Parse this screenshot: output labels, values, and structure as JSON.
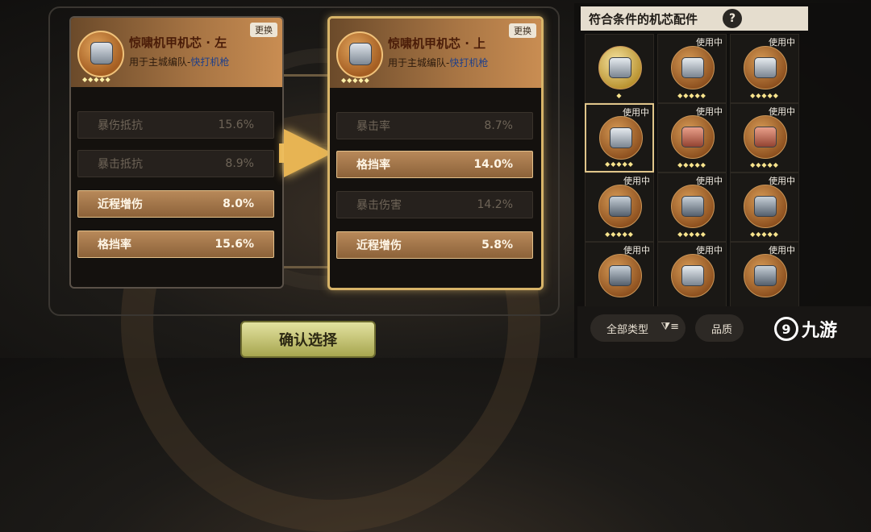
{
  "left_card": {
    "title": "惊啸机甲机芯 · 左",
    "sub_prefix": "用于主城编队-",
    "sub_highlight": "快打机枪",
    "swap": "更换",
    "stars": "◆◆◆◆◆",
    "stats": [
      {
        "name": "暴伤抵抗",
        "value": "15.6%",
        "active": false
      },
      {
        "name": "暴击抵抗",
        "value": "8.9%",
        "active": false
      },
      {
        "name": "近程增伤",
        "value": "8.0%",
        "active": true
      },
      {
        "name": "格挡率",
        "value": "15.6%",
        "active": true
      }
    ]
  },
  "right_card": {
    "title": "惊啸机甲机芯 · 上",
    "sub_prefix": "用于主城编队-",
    "sub_highlight": "快打机枪",
    "swap": "更换",
    "stars": "◆◆◆◆◆",
    "stats": [
      {
        "name": "暴击率",
        "value": "8.7%",
        "active": false
      },
      {
        "name": "格挡率",
        "value": "14.0%",
        "active": true
      },
      {
        "name": "暴击伤害",
        "value": "14.2%",
        "active": false
      },
      {
        "name": "近程增伤",
        "value": "5.8%",
        "active": true
      }
    ]
  },
  "confirm_label": "确认选择",
  "panel": {
    "title": "符合条件的机芯配件",
    "help": "?",
    "in_use_label": "使用中",
    "cells": [
      {
        "in_use": false,
        "orb": "gold",
        "mech": "default",
        "stars": "◆"
      },
      {
        "in_use": true,
        "orb": "bronze",
        "mech": "default",
        "stars": "◆◆◆◆◆"
      },
      {
        "in_use": true,
        "orb": "bronze",
        "mech": "default",
        "stars": "◆◆◆◆◆"
      },
      {
        "in_use": true,
        "orb": "bronze",
        "mech": "default",
        "stars": "◆◆◆◆◆",
        "selected": true
      },
      {
        "in_use": true,
        "orb": "bronze",
        "mech": "red",
        "stars": "◆◆◆◆◆"
      },
      {
        "in_use": true,
        "orb": "bronze",
        "mech": "red",
        "stars": "◆◆◆◆◆"
      },
      {
        "in_use": true,
        "orb": "bronze",
        "mech": "steel",
        "stars": "◆◆◆◆◆"
      },
      {
        "in_use": true,
        "orb": "bronze",
        "mech": "steel",
        "stars": "◆◆◆◆◆"
      },
      {
        "in_use": true,
        "orb": "bronze",
        "mech": "steel",
        "stars": "◆◆◆◆◆"
      },
      {
        "in_use": true,
        "orb": "bronze",
        "mech": "steel",
        "stars": ""
      },
      {
        "in_use": true,
        "orb": "bronze",
        "mech": "default",
        "stars": ""
      },
      {
        "in_use": true,
        "orb": "bronze",
        "mech": "steel",
        "stars": ""
      }
    ]
  },
  "filters": {
    "all_types": "全部类型",
    "filter_icon": "filter-icon",
    "quality": "品质"
  },
  "watermark": {
    "logo": "9",
    "text": "九游"
  }
}
